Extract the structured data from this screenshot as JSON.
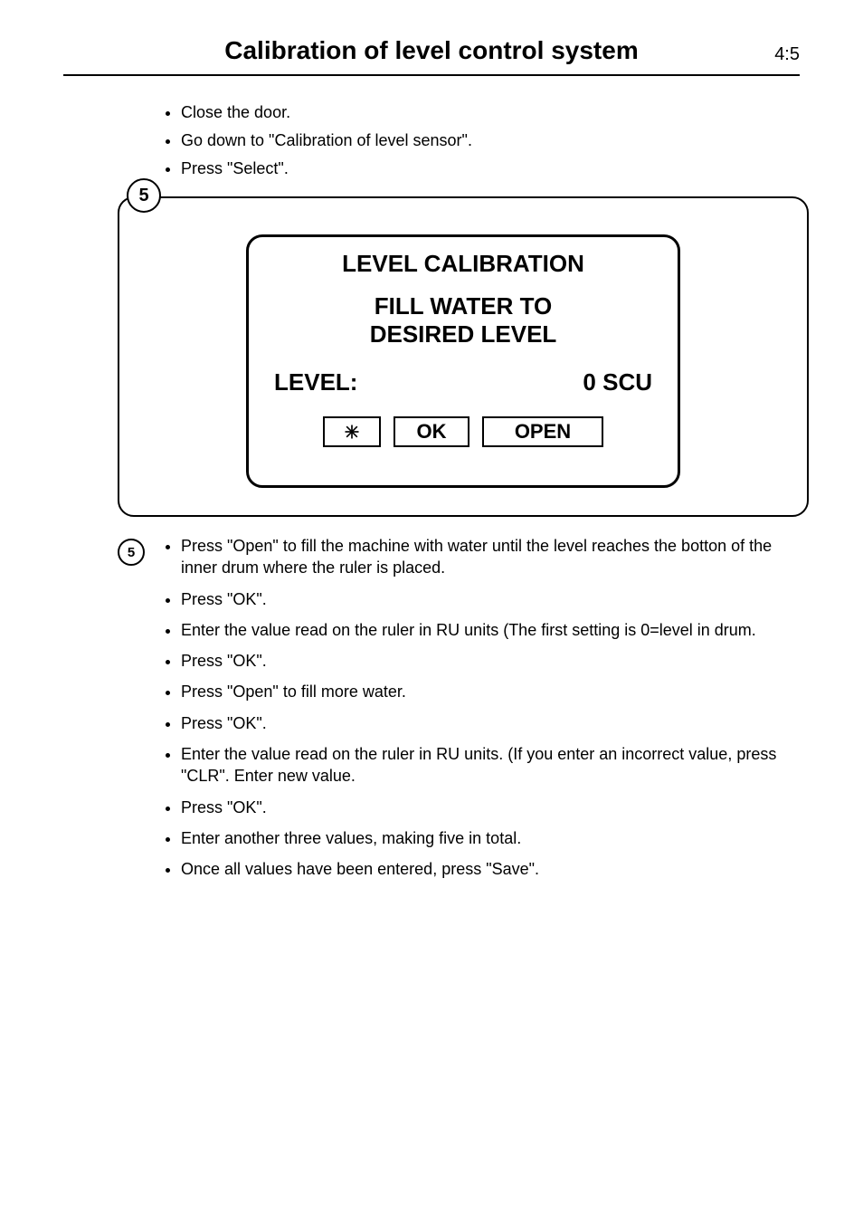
{
  "header": {
    "title": "Calibration of level control system",
    "page": "4:5"
  },
  "top_bullets": [
    "Close the door.",
    "Go down to \"Calibration of level sensor\".",
    "Press \"Select\"."
  ],
  "figure": {
    "callout_number": "5",
    "screen": {
      "title": "LEVEL CALIBRATION",
      "line1": "FILL WATER TO",
      "line2": "DESIRED LEVEL",
      "level_label": "LEVEL:",
      "level_value": "0 SCU",
      "buttons": {
        "ok": "OK",
        "open": "OPEN"
      }
    }
  },
  "step_ref": "5",
  "bottom_bullets": [
    "Press \"Open\" to fill the machine with water until the level reaches the botton of the inner drum where the ruler is placed.",
    "Press \"OK\".",
    "Enter the value read on the ruler in RU units (The first setting is 0=level in drum.",
    "Press \"OK\".",
    "Press \"Open\" to fill more water.",
    "Press \"OK\".",
    "Enter the value read on the ruler in RU units. (If you enter an incorrect value, press \"CLR\". Enter new value.",
    "Press \"OK\".",
    "Enter another three values, making five in total.",
    "Once all values have been entered, press \"Save\"."
  ]
}
